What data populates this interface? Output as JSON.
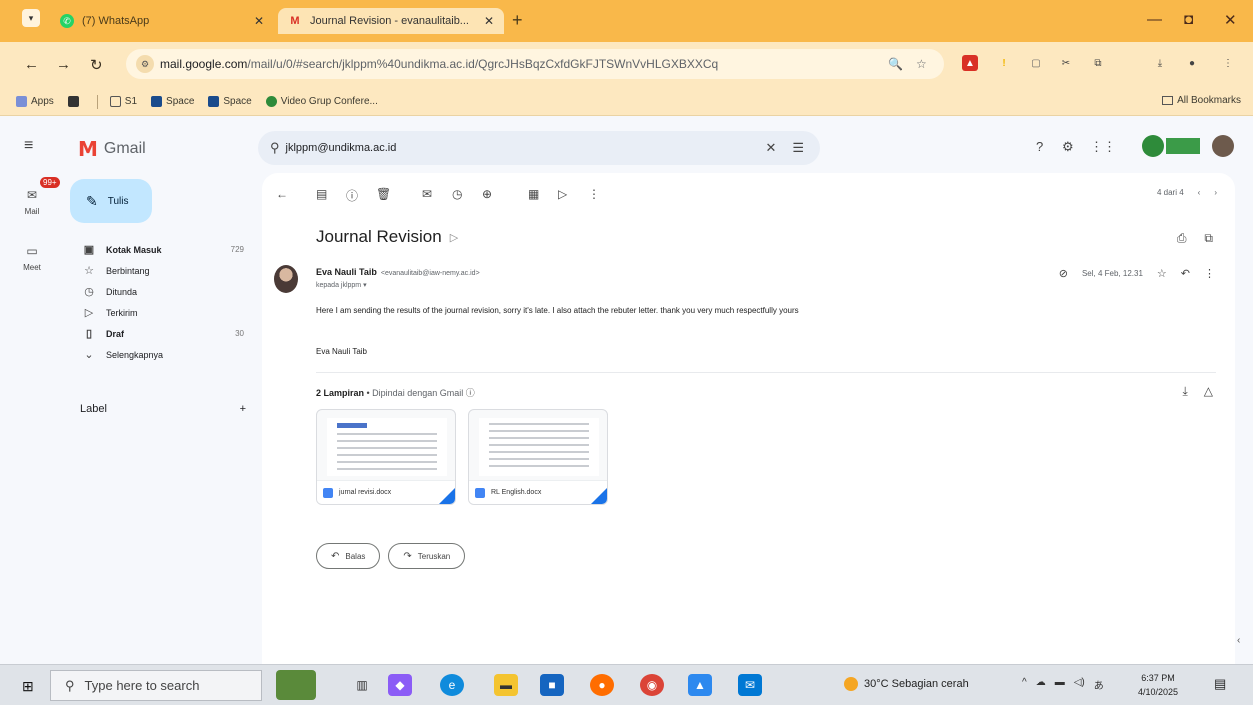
{
  "browser": {
    "tabs": [
      {
        "title": "(7) WhatsApp",
        "active": false
      },
      {
        "title": "Journal Revision - evanaulitaib...",
        "active": true
      }
    ],
    "url_host": "mail.google.com",
    "url_path": "/mail/u/0/#search/jklppm%40undikma.ac.id/QgrcJHsBqzCxfdGkFJTSWnVvHLGXBXXCq",
    "bookmarks": [
      "Apps",
      "S1",
      "Space",
      "Space",
      "Video Grup Confere..."
    ],
    "all_bookmarks": "All Bookmarks"
  },
  "gmail": {
    "app_name": "Gmail",
    "rail": {
      "mail_label": "Mail",
      "mail_badge": "99+",
      "meet_label": "Meet"
    },
    "compose_label": "Tulis",
    "nav": [
      {
        "label": "Kotak Masuk",
        "count": "729",
        "bold": true,
        "icon": "inbox-icon"
      },
      {
        "label": "Berbintang",
        "count": "",
        "bold": false,
        "icon": "star-icon"
      },
      {
        "label": "Ditunda",
        "count": "",
        "bold": false,
        "icon": "clock-icon"
      },
      {
        "label": "Terkirim",
        "count": "",
        "bold": false,
        "icon": "send-icon"
      },
      {
        "label": "Draf",
        "count": "30",
        "bold": true,
        "icon": "draft-icon"
      },
      {
        "label": "Selengkapnya",
        "count": "",
        "bold": false,
        "icon": "chevron-down-icon"
      }
    ],
    "labels_heading": "Label",
    "search_value": "jklppm@undikma.ac.id",
    "pager_text": "4 dari 4",
    "subject": "Journal Revision",
    "sender_name": "Eva Nauli Taib",
    "sender_email": "<evanaulitaib@iaw-nemy.ac.id>",
    "to_line": "kepada jklppm",
    "date": "Sel, 4 Feb, 12.31",
    "body": "Here I am sending the results of the journal revision, sorry it's late. I also attach the rebuter letter. thank you very much respectfully yours",
    "signature": "Eva Nauli Taib",
    "attachments_title": "2 Lampiran",
    "attachments_scan": "Dipindai dengan Gmail",
    "attachments": [
      {
        "name": "jurnal revisi.docx"
      },
      {
        "name": "RL English.docx"
      }
    ],
    "reply_label": "Balas",
    "forward_label": "Teruskan"
  },
  "taskbar": {
    "search_placeholder": "Type here to search",
    "weather": "30°C  Sebagian cerah",
    "time": "6:37 PM",
    "date": "4/10/2025"
  },
  "colors": {
    "chrome_tab_strip": "#f9b84a",
    "chrome_toolbar": "#fde8c0",
    "compose_button": "#c2e7ff",
    "gmail_red": "#ea4335"
  }
}
